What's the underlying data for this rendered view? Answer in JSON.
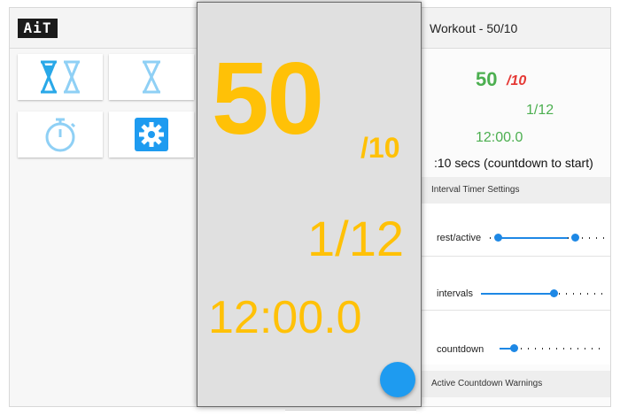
{
  "app": {
    "logo": "AiT"
  },
  "left_tiles": [
    {
      "icon": "double-hourglass-icon"
    },
    {
      "icon": "hourglass-icon"
    },
    {
      "icon": "stopwatch-icon"
    },
    {
      "icon": "gear-icon"
    }
  ],
  "right": {
    "title": "Workout - 50/10",
    "big": "50",
    "den": "/10",
    "interval": "1/12",
    "time": "12:00.0",
    "countdown_text": ":10 secs (countdown to start)",
    "section_settings": "Interval Timer Settings",
    "settings": [
      {
        "label": "rest/active",
        "fill_low": 0.12,
        "fill_high": 0.73
      },
      {
        "label": "intervals",
        "fill": 0.58
      },
      {
        "label": "countdown",
        "fill": 0.13
      }
    ],
    "section_warnings": "Active Countdown Warnings"
  },
  "overlay": {
    "big": "50",
    "den": "/10",
    "interval": "1/12",
    "time": "12:00.0"
  },
  "colors": {
    "accent": "#1e88e5",
    "active_yellow": "#ffc107",
    "green": "#4caf50",
    "red": "#e53935"
  }
}
